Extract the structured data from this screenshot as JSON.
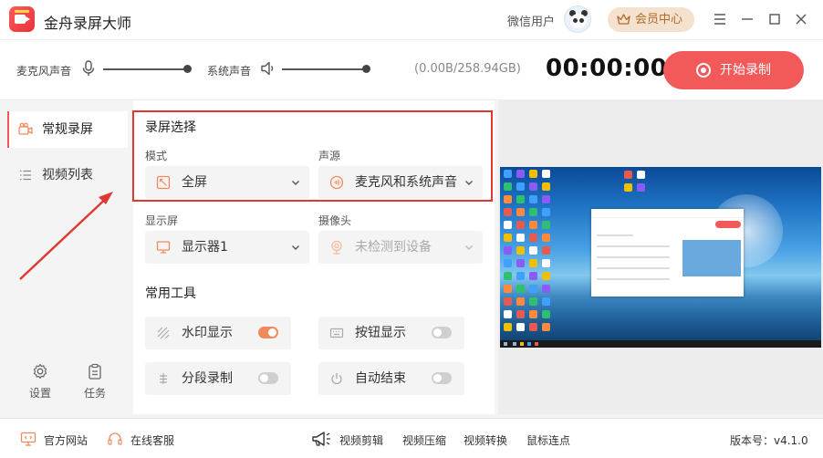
{
  "app": {
    "title": "金舟录屏大师"
  },
  "header": {
    "user_name": "微信用户",
    "vip_label": "会员中心"
  },
  "audio": {
    "mic_label": "麦克风声音",
    "mic_level": 1.0,
    "system_label": "系统声音",
    "system_level": 1.0,
    "storage": "(0.00B/258.94GB)",
    "timer": "00:00:00",
    "record_label": "开始录制"
  },
  "sidebar": {
    "items": [
      {
        "label": "常规录屏",
        "active": true
      },
      {
        "label": "视频列表",
        "active": false
      }
    ],
    "settings_label": "设置",
    "tasks_label": "任务"
  },
  "screen_selection": {
    "title": "录屏选择",
    "mode_label": "模式",
    "mode_value": "全屏",
    "audio_source_label": "声源",
    "audio_source_value": "麦克风和系统声音"
  },
  "display": {
    "display_label": "显示屏",
    "display_value": "显示器1",
    "camera_label": "摄像头",
    "camera_value": "未检测到设备"
  },
  "tools": {
    "title": "常用工具",
    "items": [
      {
        "label": "水印显示",
        "on": true
      },
      {
        "label": "按钮显示",
        "on": false
      },
      {
        "label": "分段录制",
        "on": false
      },
      {
        "label": "自动结束",
        "on": false
      }
    ]
  },
  "footer": {
    "website": "官方网站",
    "support": "在线客服",
    "links": [
      "视频剪辑",
      "视频压缩",
      "视频转换",
      "鼠标连点"
    ],
    "version": "版本号：v4.1.0"
  },
  "colors": {
    "accent": "#f25a5a",
    "highlight_border": "#e0372f",
    "toggle_on": "#f08a5d",
    "vip_bg": "#f4e2cf"
  }
}
